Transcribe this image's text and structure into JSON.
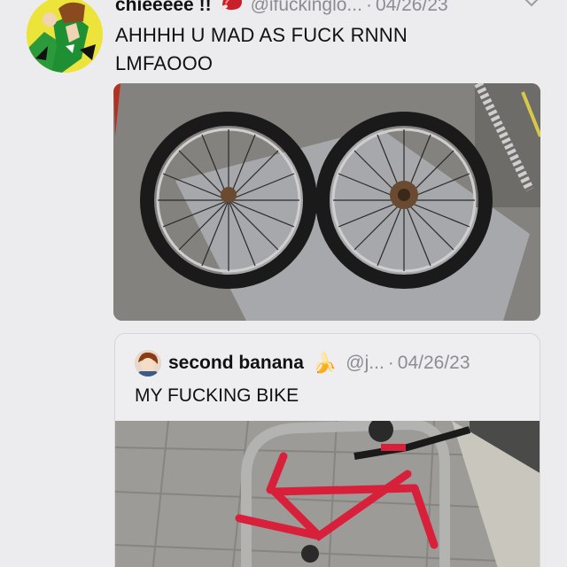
{
  "tweet": {
    "display_name": "chieeeee !!",
    "name_emoji": "meat-emoji",
    "handle": "@ifuckinglo...",
    "separator": "·",
    "date": "04/26/23",
    "text_line1": "AHHHH U MAD AS FUCK RNNN",
    "text_line2": "LMFAOOO",
    "media_icon": "bike-wheels-photo"
  },
  "quote": {
    "display_name": "second banana",
    "name_emoji": "🍌",
    "handle": "@j...",
    "separator": "·",
    "date": "04/26/23",
    "text": "MY FUCKING BIKE",
    "media_icon": "red-bike-frame-photo"
  },
  "colors": {
    "background": "#ececee",
    "handle_gray": "#8a8d93",
    "bike_red": "#d8203a"
  }
}
